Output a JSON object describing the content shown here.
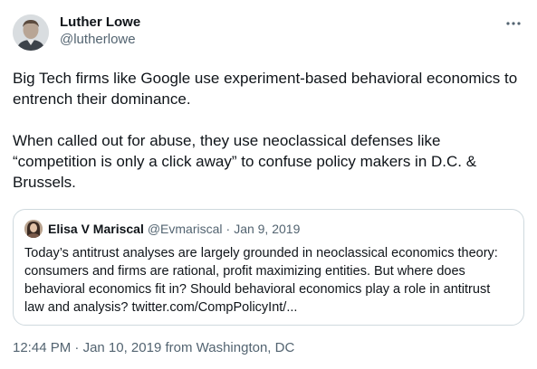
{
  "author": {
    "name": "Luther Lowe",
    "handle": "@lutherlowe"
  },
  "icons": {
    "more": "more-icon"
  },
  "tweet": {
    "text": "Big Tech firms like Google use experiment-based behavioral economics to entrench their dominance.\n\nWhen called out for abuse, they use neoclassical defenses like “competition is only a click away” to confuse policy makers in D.C. & Brussels."
  },
  "quote": {
    "name": "Elisa V Mariscal",
    "handle": "@Evmariscal",
    "separator": "·",
    "date": "Jan 9, 2019",
    "text": "Today’s antitrust analyses are largely grounded in neoclassical economics theory: consumers and firms are rational, profit maximizing entities. But where does behavioral economics fit in? Should behavioral economics play a role in antitrust law and analysis? twitter.com/CompPolicyInt/..."
  },
  "meta": {
    "time": "12:44 PM",
    "separator": " · ",
    "date": "Jan 10, 2019",
    "source": " from Washington, DC"
  },
  "colors": {
    "text": "#0f1419",
    "secondary": "#536471",
    "border": "#cfd9de"
  }
}
